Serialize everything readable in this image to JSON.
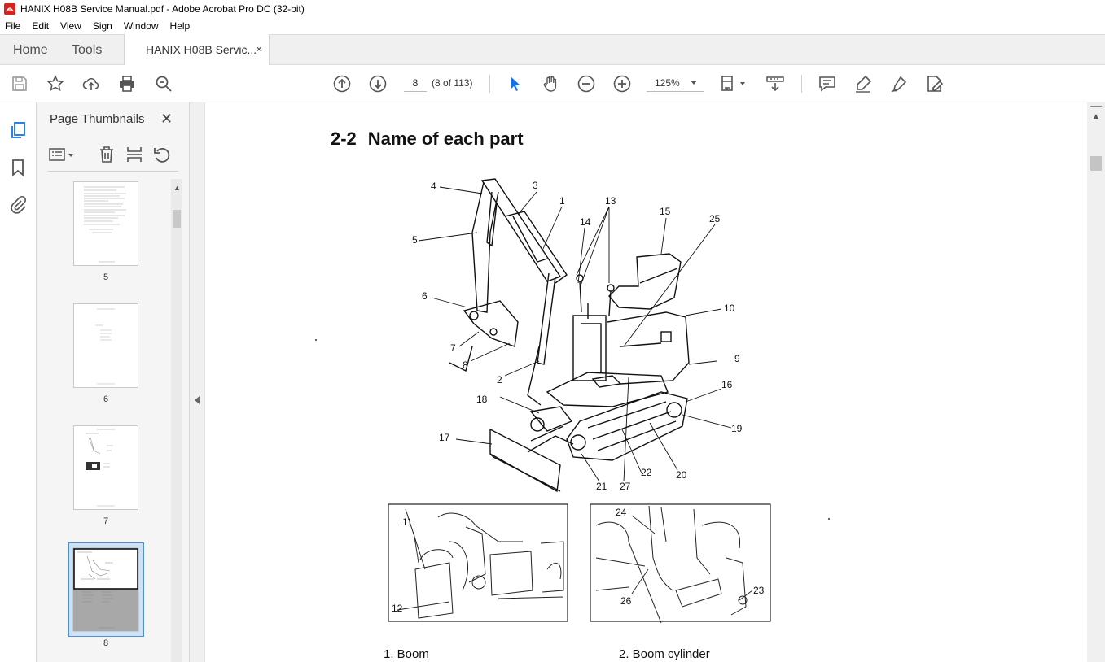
{
  "window": {
    "title": "HANIX H08B Service Manual.pdf - Adobe Acrobat Pro DC (32-bit)"
  },
  "menu": [
    "File",
    "Edit",
    "View",
    "Sign",
    "Window",
    "Help"
  ],
  "tabs": {
    "home": "Home",
    "tools": "Tools",
    "document": "HANIX H08B Servic...",
    "close": "×"
  },
  "toolbar": {
    "icons": [
      "save-icon",
      "bookmark-star-icon",
      "upload-icon",
      "print-icon",
      "zoom-search-icon",
      "prev-page-icon",
      "next-page-icon",
      "select-arrow-icon",
      "hand-icon",
      "zoom-out-icon",
      "zoom-in-icon",
      "fit-page-icon",
      "scroll-mode-icon",
      "comment-icon",
      "highlight-icon",
      "sign-icon",
      "edit-pdf-icon"
    ],
    "page_current": "8",
    "page_count": "(8 of 113)",
    "zoom": "125%"
  },
  "side_panel": {
    "title": "Page Thumbnails",
    "close": "✕",
    "thumbnails": [
      {
        "label": "5"
      },
      {
        "label": "6"
      },
      {
        "label": "7"
      },
      {
        "label": "8",
        "selected": true
      }
    ]
  },
  "document": {
    "heading_number": "2-2",
    "heading_text": "Name of each part",
    "callouts": [
      "1",
      "2",
      "3",
      "4",
      "5",
      "6",
      "7",
      "8",
      "9",
      "10",
      "11",
      "12",
      "13",
      "14",
      "15",
      "16",
      "17",
      "18",
      "19",
      "20",
      "21",
      "22",
      "23",
      "24",
      "25",
      "26",
      "27"
    ],
    "captions": [
      "1. Boom",
      "2. Boom cylinder"
    ]
  },
  "colors": {
    "accent": "#1473e6",
    "acrobat_red": "#d7231e",
    "selected_thumb": "#cfe1f5"
  }
}
